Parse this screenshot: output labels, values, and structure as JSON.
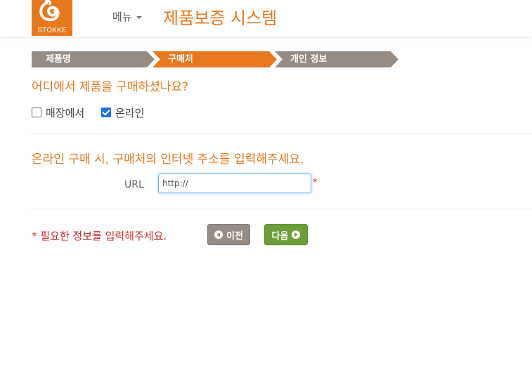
{
  "header": {
    "logo_text": "STOKKE",
    "menu_label": "메뉴",
    "system_title": "제품보증 시스템"
  },
  "steps": [
    {
      "label": "제품명",
      "state": "done"
    },
    {
      "label": "구매처",
      "state": "active"
    },
    {
      "label": "개인 정보",
      "state": "pending"
    }
  ],
  "colors": {
    "accent": "#e8781e",
    "step_inactive": "#958d85",
    "next_button": "#6d9e3a",
    "required": "#c9302c"
  },
  "purchase": {
    "question": "어디에서 제품을 구매하셨나요?",
    "options": [
      {
        "label": "매장에서",
        "checked": false
      },
      {
        "label": "온라인",
        "checked": true
      }
    ]
  },
  "online": {
    "question": "온라인 구매 시, 구매처의 인터넷 주소를 입력해주세요.",
    "url_label": "URL",
    "url_value": "http://",
    "required_mark": "*"
  },
  "footer": {
    "required_note": "* 필요한 정보를 입력해주세요.",
    "prev_label": "이전",
    "next_label": "다음"
  },
  "icons": {
    "prev": "chevron-left-circle-icon",
    "next": "chevron-right-circle-icon",
    "menu_caret": "caret-down-icon"
  }
}
